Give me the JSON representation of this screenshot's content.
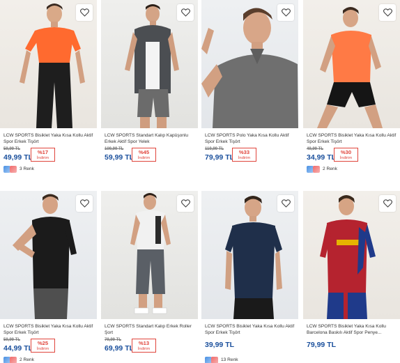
{
  "products": [
    {
      "name": "LCW SPORTS Bisiklet Yaka Kısa Kollu Aktif Spor Erkek Tişört",
      "old_price": "59,99 TL",
      "price": "49,99 TL",
      "discount": "%17",
      "discount_label": "İndirim",
      "color_count": "3 Renk",
      "shirt_color": "#ff6a2f",
      "pants_color": "#1e1e1e"
    },
    {
      "name": "LCW SPORTS Standart Kalıp Kapüşonlu Erkek Aktif Spor Yelek",
      "old_price": "109,99 TL",
      "price": "59,99 TL",
      "discount": "%45",
      "discount_label": "İndirim",
      "shirt_color": "#f4f4f4",
      "pants_color": "#6b6b6b"
    },
    {
      "name": "LCW SPORTS Polo Yaka Kısa Kollu Aktif Spor Erkek Tişört",
      "old_price": "119,99 TL",
      "price": "79,99 TL",
      "discount": "%33",
      "discount_label": "İndirim",
      "shirt_color": "#6f6f6f",
      "pants_color": "#6f6f6f"
    },
    {
      "name": "LCW SPORTS Bisiklet Yaka Kısa Kollu Aktif Spor Erkek Tişört",
      "old_price": "49,99 TL",
      "price": "34,99 TL",
      "discount": "%30",
      "discount_label": "İndirim",
      "color_count": "2 Renk",
      "shirt_color": "#ff7a45",
      "pants_color": "#151515"
    },
    {
      "name": "LCW SPORTS Bisiklet Yaka Kısa Kollu Aktif Spor Erkek Tişört",
      "old_price": "59,99 TL",
      "price": "44,99 TL",
      "discount": "%25",
      "discount_label": "İndirim",
      "color_count": "2 Renk",
      "shirt_color": "#1b1b1b",
      "pants_color": "#4f4f4f"
    },
    {
      "name": "LCW SPORTS Standart Kalıp Erkek Roller Şort",
      "old_price": "79,99 TL",
      "price": "69,99 TL",
      "discount": "%13",
      "discount_label": "İndirim",
      "shirt_color": "#f1f1f1",
      "pants_color": "#5a5f66"
    },
    {
      "name": "LCW SPORTS Bisiklet Yaka Kısa Kollu Aktif Spor Erkek Tişört",
      "price": "39,99 TL",
      "color_count": "13 Renk",
      "shirt_color": "#1f2f4a",
      "pants_color": "#1a1a1a"
    },
    {
      "name": "LCW SPORTS Bisiklet Yaka Kısa Kollu Barcelona Baskılı Aktif Spor Penye...",
      "price": "79,99 TL",
      "shirt_color": "#b5232f",
      "pants_color": "#1f3a8a"
    }
  ],
  "icons": {
    "favorite": "heart-icon",
    "swatch_blue": "#4a90e2",
    "swatch_pink": "#f06a6a"
  },
  "colors": {
    "price_blue": "#1a4f9c",
    "discount_red": "#e0443b"
  }
}
